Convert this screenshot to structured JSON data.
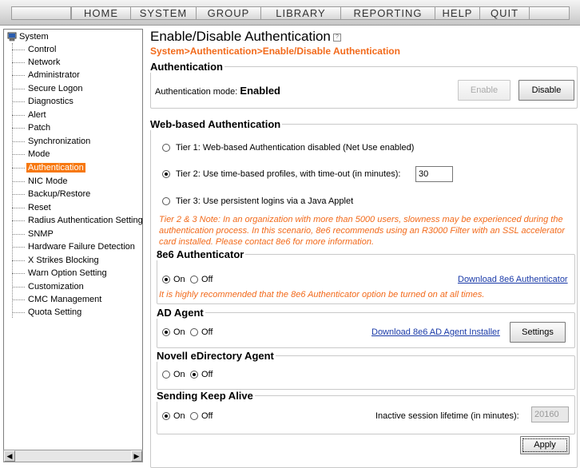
{
  "menu": [
    "HOME",
    "SYSTEM",
    "GROUP",
    "LIBRARY",
    "REPORTING",
    "HELP",
    "QUIT"
  ],
  "sidebar": {
    "root": "System",
    "items": [
      "Control",
      "Network",
      "Administrator",
      "Secure Logon",
      "Diagnostics",
      "Alert",
      "Patch",
      "Synchronization",
      "Mode",
      "Authentication",
      "NIC Mode",
      "Backup/Restore",
      "Reset",
      "Radius Authentication Setting",
      "SNMP",
      "Hardware Failure Detection",
      "X Strikes Blocking",
      "Warn Option Setting",
      "Customization",
      "CMC Management",
      "Quota Setting"
    ],
    "selected": "Authentication"
  },
  "page": {
    "title": "Enable/Disable Authentication",
    "breadcrumb": "System>Authentication>Enable/Disable Authentication"
  },
  "auth": {
    "legend": "Authentication",
    "mode_label": "Authentication mode:",
    "mode_value": "Enabled",
    "enable": "Enable",
    "disable": "Disable"
  },
  "web": {
    "legend": "Web-based Authentication",
    "tier1": "Tier 1: Web-based Authentication disabled (Net Use enabled)",
    "tier2": "Tier 2: Use time-based profiles, with time-out (in minutes):",
    "tier2_value": "30",
    "tier3": "Tier 3: Use persistent logins via a Java Applet",
    "selected_tier": 2,
    "note_line1": "Tier 2 & 3 Note: In an organization with more than 5000 users, slowness may be experienced during the",
    "note_line2": "authentication process.  In this scenario, 8e6 recommends using an R3000 Filter with an SSL accelerator",
    "note_line3": "card installed.  Please contact 8e6 for more information."
  },
  "authenticator": {
    "legend": "8e6 Authenticator",
    "on": "On",
    "off": "Off",
    "selected": "On",
    "download": "Download 8e6 Authenticator",
    "note": "It is highly recommended that the 8e6 Authenticator option be turned on at all times."
  },
  "ad_agent": {
    "legend": "AD Agent",
    "on": "On",
    "off": "Off",
    "selected": "On",
    "download": "Download 8e6 AD Agent Installer",
    "settings": "Settings"
  },
  "novell": {
    "legend": "Novell eDirectory Agent",
    "on": "On",
    "off": "Off",
    "selected": "Off"
  },
  "keepalive": {
    "legend": "Sending Keep Alive",
    "on": "On",
    "off": "Off",
    "selected": "On",
    "lifetime_label": "Inactive session lifetime (in minutes):",
    "lifetime_value": "20160"
  },
  "apply": "Apply",
  "colors": {
    "accent": "#f26a1b",
    "selected_bg": "#f7780f",
    "link": "#1a3aa8"
  }
}
